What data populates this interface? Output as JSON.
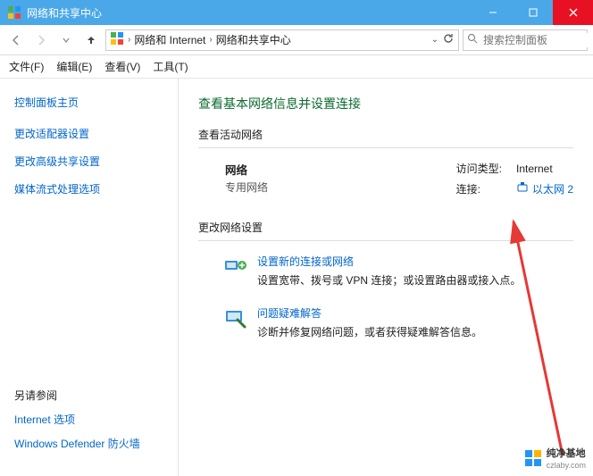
{
  "title": "网络和共享中心",
  "breadcrumb": {
    "root": "网络和 Internet",
    "current": "网络和共享中心"
  },
  "search_placeholder": "搜索控制面板",
  "menubar": {
    "file": "文件(F)",
    "edit": "编辑(E)",
    "view": "查看(V)",
    "tools": "工具(T)"
  },
  "sidebar": {
    "home": "控制面板主页",
    "links": {
      "adapter": "更改适配器设置",
      "advanced": "更改高级共享设置",
      "streaming": "媒体流式处理选项"
    },
    "seealso_title": "另请参阅",
    "seealso": {
      "internet_options": "Internet 选项",
      "defender": "Windows Defender 防火墙"
    }
  },
  "main": {
    "heading": "查看基本网络信息并设置连接",
    "active_networks_title": "查看活动网络",
    "network": {
      "name": "网络",
      "type": "专用网络",
      "access_label": "访问类型:",
      "access_value": "Internet",
      "connection_label": "连接:",
      "connection_value": "以太网 2"
    },
    "change_settings_title": "更改网络设置",
    "task_new_connection": {
      "title": "设置新的连接或网络",
      "desc": "设置宽带、拨号或 VPN 连接；或设置路由器或接入点。"
    },
    "task_troubleshoot": {
      "title": "问题疑难解答",
      "desc": "诊断并修复网络问题，或者获得疑难解答信息。"
    }
  },
  "watermark": {
    "name": "纯净基地",
    "url": "czlaby.com"
  }
}
